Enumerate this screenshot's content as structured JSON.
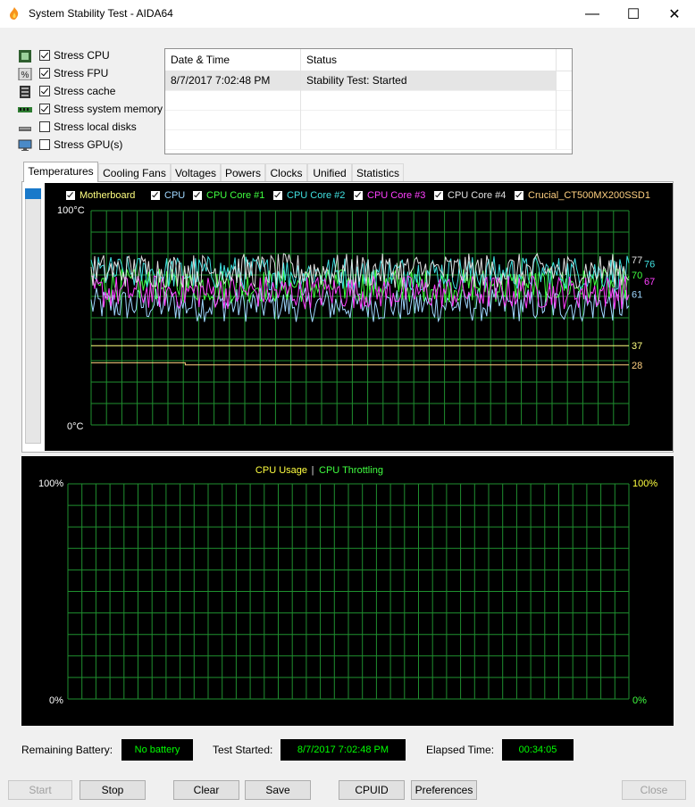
{
  "window": {
    "title": "System Stability Test - AIDA64",
    "controls": {
      "minimize": "—",
      "maximize": "☐",
      "close": "✕"
    },
    "app_icon": "flame-icon"
  },
  "stress_options": [
    {
      "label": "Stress CPU",
      "checked": true,
      "icon": "cpu-chip-icon"
    },
    {
      "label": "Stress FPU",
      "checked": true,
      "icon": "fpu-icon"
    },
    {
      "label": "Stress cache",
      "checked": true,
      "icon": "cache-icon"
    },
    {
      "label": "Stress system memory",
      "checked": true,
      "icon": "memory-module-icon"
    },
    {
      "label": "Stress local disks",
      "checked": false,
      "icon": "disk-drive-icon"
    },
    {
      "label": "Stress GPU(s)",
      "checked": false,
      "icon": "monitor-icon"
    }
  ],
  "status_table": {
    "columns": [
      "Date & Time",
      "Status"
    ],
    "rows": [
      [
        "8/7/2017 7:02:48 PM",
        "Stability Test: Started"
      ]
    ]
  },
  "tabs": [
    {
      "label": "Temperatures",
      "active": true
    },
    {
      "label": "Cooling Fans",
      "active": false
    },
    {
      "label": "Voltages",
      "active": false
    },
    {
      "label": "Powers",
      "active": false
    },
    {
      "label": "Clocks",
      "active": false
    },
    {
      "label": "Unified",
      "active": false
    },
    {
      "label": "Statistics",
      "active": false
    }
  ],
  "temperature_legend": [
    {
      "label": "Motherboard",
      "color": "#ffff80"
    },
    {
      "label": "CPU",
      "color": "#9fd7ff"
    },
    {
      "label": "CPU Core #1",
      "color": "#40ff40"
    },
    {
      "label": "CPU Core #2",
      "color": "#40e0e0"
    },
    {
      "label": "CPU Core #3",
      "color": "#ff40ff"
    },
    {
      "label": "CPU Core #4",
      "color": "#e0e0e0"
    },
    {
      "label": "Crucial_CT500MX200SSD1",
      "color": "#ffd080"
    }
  ],
  "chart_data": [
    {
      "type": "line",
      "title": "",
      "y_top_label": "100°C",
      "y_bottom_label": "0°C",
      "ylim": [
        0,
        100
      ],
      "grid": true,
      "series": [
        {
          "name": "Motherboard",
          "color": "#ffff80",
          "current": 37
        },
        {
          "name": "CPU",
          "color": "#9fd7ff",
          "current": 61
        },
        {
          "name": "CPU Core #1",
          "color": "#40ff40",
          "current": 70
        },
        {
          "name": "CPU Core #2",
          "color": "#40e0e0",
          "current": 76
        },
        {
          "name": "CPU Core #3",
          "color": "#ff40ff",
          "current": 67
        },
        {
          "name": "CPU Core #4",
          "color": "#e0e0e0",
          "current": 77
        },
        {
          "name": "Crucial_CT500MX200SSD1",
          "color": "#ffd080",
          "current": 28,
          "earlier": 29
        }
      ],
      "value_labels": [
        {
          "text": "77",
          "color": "#e0e0e0"
        },
        {
          "text": "76",
          "color": "#40e0e0"
        },
        {
          "text": "70",
          "color": "#40ff40"
        },
        {
          "text": "67",
          "color": "#ff40ff"
        },
        {
          "text": "61",
          "color": "#9fd7ff"
        },
        {
          "text": "37",
          "color": "#ffff80"
        },
        {
          "text": "28",
          "color": "#ffd080"
        }
      ]
    },
    {
      "type": "line",
      "title_parts": [
        "CPU Usage",
        "|",
        "CPU Throttling"
      ],
      "title_colors": [
        "#ffff40",
        "#e0e0e0",
        "#40ff40"
      ],
      "y_left_top": "100%",
      "y_left_bottom": "0%",
      "y_right_top": "100%",
      "y_right_bottom": "0%",
      "ylim": [
        0,
        100
      ],
      "grid": true,
      "series": []
    }
  ],
  "info": {
    "battery_label": "Remaining Battery:",
    "battery_value": "No battery",
    "started_label": "Test Started:",
    "started_value": "8/7/2017 7:02:48 PM",
    "elapsed_label": "Elapsed Time:",
    "elapsed_value": "00:34:05"
  },
  "buttons": {
    "start": "Start",
    "stop": "Stop",
    "clear": "Clear",
    "save": "Save",
    "cpuid": "CPUID",
    "preferences": "Preferences",
    "close": "Close"
  }
}
